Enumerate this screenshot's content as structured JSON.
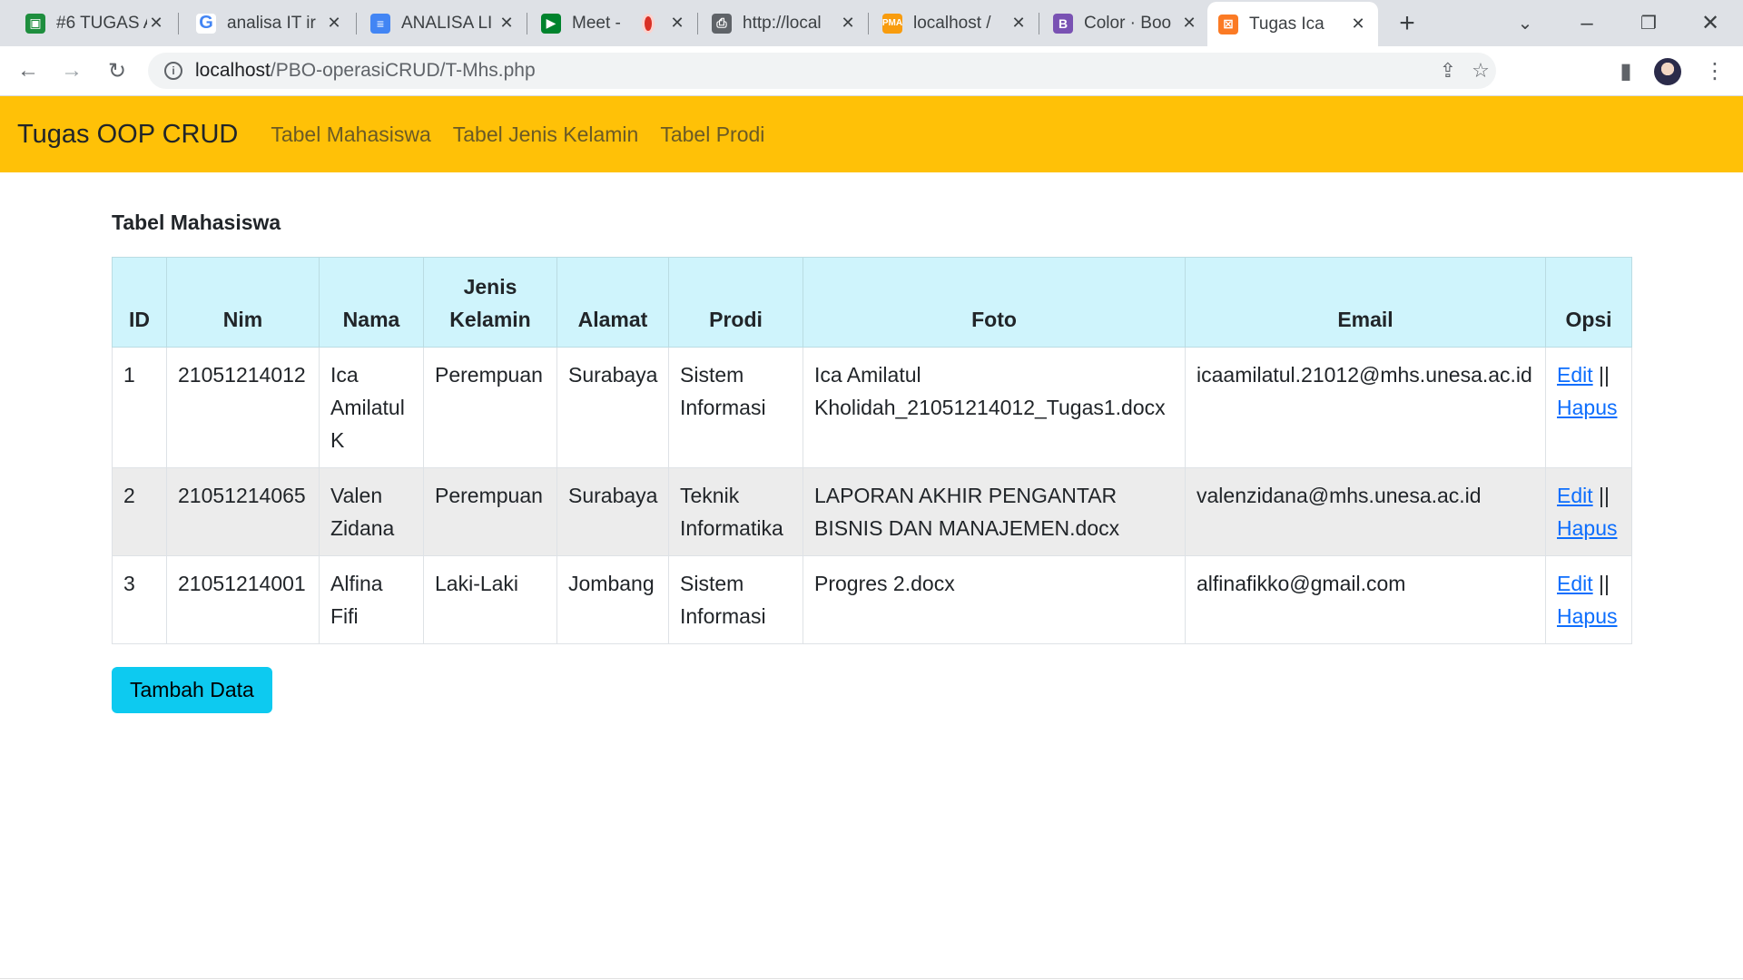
{
  "browser": {
    "tabs": [
      {
        "title": "#6 TUGAS A",
        "icon": "classroom-icon",
        "color": "#1e8e3e"
      },
      {
        "title": "analisa IT ir",
        "icon": "google-icon",
        "color": "#4285f4"
      },
      {
        "title": "ANALISA LI",
        "icon": "docs-icon",
        "color": "#4285f4"
      },
      {
        "title": "Meet -",
        "icon": "meet-icon",
        "color": "#00832d"
      },
      {
        "title": "http://local",
        "icon": "printer-icon",
        "color": "#5f6368"
      },
      {
        "title": "localhost /",
        "icon": "phpmyadmin-icon",
        "color": "#f89c0e"
      },
      {
        "title": "Color · Boo",
        "icon": "bootstrap-icon",
        "color": "#7952b3"
      },
      {
        "title": "Tugas Ica",
        "icon": "xampp-icon",
        "color": "#fb7a24"
      }
    ],
    "url_host": "localhost",
    "url_path": "/PBO-operasiCRUD/T-Mhs.php"
  },
  "navbar": {
    "brand": "Tugas OOP CRUD",
    "links": [
      "Tabel Mahasiswa",
      "Tabel Jenis Kelamin",
      "Tabel Prodi"
    ],
    "color": "#ffc107"
  },
  "main": {
    "title": "Tabel Mahasiswa",
    "table": {
      "headers": [
        "ID",
        "Nim",
        "Nama",
        "Jenis Kelamin",
        "Alamat",
        "Prodi",
        "Foto",
        "Email",
        "Opsi"
      ],
      "rows": [
        {
          "id": "1",
          "nim": "21051214012",
          "nama": "Ica Amilatul K",
          "jk": "Perempuan",
          "alamat": "Surabaya",
          "prodi": "Sistem Informasi",
          "foto": "Ica Amilatul Kholidah_21051214012_Tugas1.docx",
          "email": "icaamilatul.21012@mhs.unesa.ac.id"
        },
        {
          "id": "2",
          "nim": "21051214065",
          "nama": "Valen Zidana",
          "jk": "Perempuan",
          "alamat": "Surabaya",
          "prodi": "Teknik Informatika",
          "foto": "LAPORAN AKHIR PENGANTAR BISNIS DAN MANAJEMEN.docx",
          "email": "valenzidana@mhs.unesa.ac.id"
        },
        {
          "id": "3",
          "nim": "21051214001",
          "nama": "Alfina Fifi",
          "jk": "Laki-Laki",
          "alamat": "Jombang",
          "prodi": "Sistem Informasi",
          "foto": "Progres 2.docx",
          "email": "alfinafikko@gmail.com"
        }
      ],
      "edit_label": "Edit",
      "separator": "||",
      "delete_label": "Hapus"
    },
    "add_button": "Tambah Data"
  }
}
